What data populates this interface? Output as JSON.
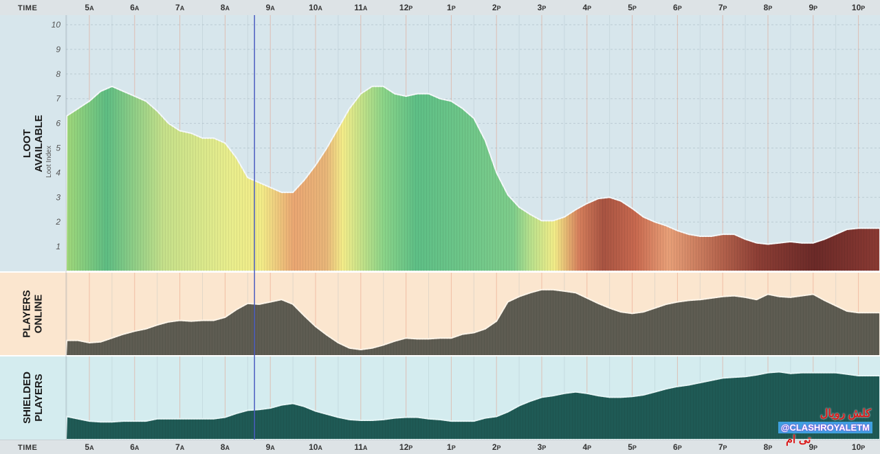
{
  "time_label": "TIME",
  "hours": [
    {
      "n": "5",
      "s": "A"
    },
    {
      "n": "6",
      "s": "A"
    },
    {
      "n": "7",
      "s": "A"
    },
    {
      "n": "8",
      "s": "A"
    },
    {
      "n": "9",
      "s": "A"
    },
    {
      "n": "10",
      "s": "A"
    },
    {
      "n": "11",
      "s": "A"
    },
    {
      "n": "12",
      "s": "P"
    },
    {
      "n": "1",
      "s": "P"
    },
    {
      "n": "2",
      "s": "P"
    },
    {
      "n": "3",
      "s": "P"
    },
    {
      "n": "4",
      "s": "P"
    },
    {
      "n": "5",
      "s": "P"
    },
    {
      "n": "6",
      "s": "P"
    },
    {
      "n": "7",
      "s": "P"
    },
    {
      "n": "8",
      "s": "P"
    },
    {
      "n": "9",
      "s": "P"
    },
    {
      "n": "10",
      "s": "P"
    }
  ],
  "panels": {
    "loot": {
      "label": "LOOT\nAVAILABLE",
      "ylabel": "Loot Index"
    },
    "players": {
      "label": "PLAYERS\nONLINE"
    },
    "shielded": {
      "label": "SHIELDED\nPLAYERS"
    }
  },
  "watermark": {
    "arabic_top": "کلش رویال",
    "handle": "@CLASHROYALETM",
    "arabic_bottom": "تی ام"
  },
  "chart_data": {
    "type": "area",
    "x_labels": [
      "5A",
      "6A",
      "7A",
      "8A",
      "9A",
      "10A",
      "11A",
      "12P",
      "1P",
      "2P",
      "3P",
      "4P",
      "5P",
      "6P",
      "7P",
      "8P",
      "9P",
      "10P"
    ],
    "current_time_marker": 8.65,
    "charts": [
      {
        "name": "loot",
        "ylabel": "Loot Index",
        "ylim": [
          0,
          10
        ],
        "yticks": [
          1,
          2,
          3,
          4,
          5,
          6,
          7,
          8,
          9,
          10
        ],
        "x": [
          4.5,
          4.75,
          5.0,
          5.25,
          5.5,
          5.75,
          6.0,
          6.25,
          6.5,
          6.75,
          7.0,
          7.25,
          7.5,
          7.75,
          8.0,
          8.25,
          8.5,
          8.75,
          9.0,
          9.25,
          9.5,
          9.75,
          10.0,
          10.25,
          10.5,
          10.75,
          11.0,
          11.25,
          11.5,
          11.75,
          12.0,
          12.25,
          12.5,
          12.75,
          13.0,
          13.25,
          13.5,
          13.75,
          14.0,
          14.25,
          14.5,
          14.75,
          15.0,
          15.25,
          15.5,
          15.75,
          16.0,
          16.25,
          16.5,
          16.75,
          17.0,
          17.25,
          17.5,
          17.75,
          18.0,
          18.25,
          18.5,
          18.75,
          19.0,
          19.25,
          19.5,
          19.75,
          20.0,
          20.25,
          20.5,
          20.75,
          21.0,
          21.25,
          21.5,
          21.75,
          22.0,
          22.25,
          22.5
        ],
        "values": [
          6.3,
          6.6,
          6.9,
          7.3,
          7.5,
          7.3,
          7.1,
          6.9,
          6.5,
          6.0,
          5.7,
          5.6,
          5.4,
          5.4,
          5.2,
          4.6,
          3.8,
          3.6,
          3.4,
          3.2,
          3.2,
          3.7,
          4.3,
          5.0,
          5.8,
          6.6,
          7.2,
          7.5,
          7.5,
          7.2,
          7.1,
          7.2,
          7.2,
          7.0,
          6.9,
          6.6,
          6.2,
          5.3,
          4.0,
          3.1,
          2.6,
          2.3,
          2.05,
          2.05,
          2.2,
          2.5,
          2.75,
          2.95,
          3.0,
          2.85,
          2.55,
          2.2,
          2.0,
          1.85,
          1.65,
          1.5,
          1.42,
          1.42,
          1.5,
          1.5,
          1.3,
          1.15,
          1.1,
          1.15,
          1.2,
          1.15,
          1.15,
          1.3,
          1.5,
          1.7,
          1.75,
          1.75,
          1.75
        ]
      },
      {
        "name": "players_online",
        "x": [
          4.5,
          4.75,
          5.0,
          5.25,
          5.5,
          5.75,
          6.0,
          6.25,
          6.5,
          6.75,
          7.0,
          7.25,
          7.5,
          7.75,
          8.0,
          8.25,
          8.5,
          8.75,
          9.0,
          9.25,
          9.5,
          9.75,
          10.0,
          10.25,
          10.5,
          10.75,
          11.0,
          11.25,
          11.5,
          11.75,
          12.0,
          12.25,
          12.5,
          12.75,
          13.0,
          13.25,
          13.5,
          13.75,
          14.0,
          14.25,
          14.5,
          14.75,
          15.0,
          15.25,
          15.5,
          15.75,
          16.0,
          16.25,
          16.5,
          16.75,
          17.0,
          17.25,
          17.5,
          17.75,
          18.0,
          18.25,
          18.5,
          18.75,
          19.0,
          19.25,
          19.5,
          19.75,
          20.0,
          20.25,
          20.5,
          20.75,
          21.0,
          21.25,
          21.5,
          21.75,
          22.0,
          22.25,
          22.5
        ],
        "values": [
          0.2,
          0.2,
          0.17,
          0.18,
          0.23,
          0.28,
          0.32,
          0.35,
          0.4,
          0.44,
          0.46,
          0.45,
          0.46,
          0.46,
          0.5,
          0.6,
          0.68,
          0.67,
          0.7,
          0.73,
          0.67,
          0.52,
          0.38,
          0.27,
          0.17,
          0.1,
          0.08,
          0.1,
          0.14,
          0.19,
          0.23,
          0.22,
          0.22,
          0.23,
          0.23,
          0.28,
          0.3,
          0.35,
          0.45,
          0.7,
          0.77,
          0.82,
          0.86,
          0.86,
          0.84,
          0.82,
          0.75,
          0.68,
          0.62,
          0.57,
          0.55,
          0.57,
          0.62,
          0.67,
          0.7,
          0.72,
          0.73,
          0.75,
          0.77,
          0.78,
          0.76,
          0.73,
          0.8,
          0.77,
          0.76,
          0.78,
          0.8,
          0.72,
          0.65,
          0.58,
          0.56,
          0.56,
          0.56
        ]
      },
      {
        "name": "shielded_players",
        "x": [
          4.5,
          4.75,
          5.0,
          5.25,
          5.5,
          5.75,
          6.0,
          6.25,
          6.5,
          6.75,
          7.0,
          7.25,
          7.5,
          7.75,
          8.0,
          8.25,
          8.5,
          8.75,
          9.0,
          9.25,
          9.5,
          9.75,
          10.0,
          10.25,
          10.5,
          10.75,
          11.0,
          11.25,
          11.5,
          11.75,
          12.0,
          12.25,
          12.5,
          12.75,
          13.0,
          13.25,
          13.5,
          13.75,
          14.0,
          14.25,
          14.5,
          14.75,
          15.0,
          15.25,
          15.5,
          15.75,
          16.0,
          16.25,
          16.5,
          16.75,
          17.0,
          17.25,
          17.5,
          17.75,
          18.0,
          18.25,
          18.5,
          18.75,
          19.0,
          19.25,
          19.5,
          19.75,
          20.0,
          20.25,
          20.5,
          20.75,
          21.0,
          21.25,
          21.5,
          21.75,
          22.0,
          22.25,
          22.5
        ],
        "values": [
          0.3,
          0.27,
          0.24,
          0.23,
          0.23,
          0.24,
          0.24,
          0.24,
          0.27,
          0.27,
          0.27,
          0.27,
          0.27,
          0.27,
          0.29,
          0.34,
          0.38,
          0.39,
          0.41,
          0.45,
          0.47,
          0.43,
          0.37,
          0.33,
          0.29,
          0.26,
          0.25,
          0.25,
          0.26,
          0.28,
          0.29,
          0.29,
          0.27,
          0.26,
          0.24,
          0.24,
          0.24,
          0.28,
          0.3,
          0.36,
          0.44,
          0.5,
          0.55,
          0.57,
          0.6,
          0.62,
          0.6,
          0.57,
          0.55,
          0.55,
          0.56,
          0.58,
          0.62,
          0.66,
          0.69,
          0.71,
          0.74,
          0.77,
          0.8,
          0.81,
          0.82,
          0.84,
          0.87,
          0.88,
          0.86,
          0.87,
          0.87,
          0.87,
          0.87,
          0.85,
          0.83,
          0.83,
          0.83
        ]
      }
    ]
  }
}
